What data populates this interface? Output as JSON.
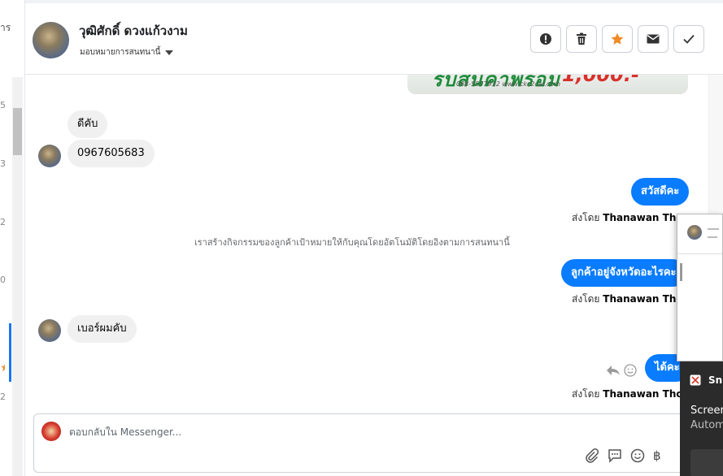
{
  "left_sidebar": {
    "fragment_top": "าร",
    "fragments": [
      "5",
      "3",
      "2",
      "0",
      "2"
    ]
  },
  "header": {
    "contact_name": "วุฒิศักดิ์ ดวงแก้วงาม",
    "assign_label": "มอบหมายการสนทนานี้",
    "actions": [
      {
        "icon": "alert-icon",
        "label": "Mark as spam"
      },
      {
        "icon": "trash-icon",
        "label": "Delete"
      },
      {
        "icon": "star-icon",
        "label": "Star"
      },
      {
        "icon": "envelope-icon",
        "label": "Mark as unread"
      },
      {
        "icon": "check-icon",
        "label": "Mark as done"
      }
    ]
  },
  "chat": {
    "image_banner": {
      "big_text": "รับสินค้าพร้อม",
      "price_text": "1,000.-",
      "small_text": "088-5577932  www.ckc2car.com"
    },
    "messages": [
      {
        "side": "in",
        "text": "ดีคับ"
      },
      {
        "side": "in",
        "text": "0967605683"
      },
      {
        "side": "out",
        "text": "สวัสดีคะ",
        "sent_by_prefix": "ส่งโดย",
        "sent_by": "Thanawan Thon"
      },
      {
        "side": "out",
        "text": "ลูกค้าอยู่จังหวัดอะไรคะ",
        "sent_by_prefix": "ส่งโดย",
        "sent_by": "Thanawan Thon"
      },
      {
        "side": "in",
        "text": "เบอร์ผมคับ"
      },
      {
        "side": "out",
        "text": "ได้คะ",
        "sent_by_prefix": "ส่งโดย",
        "sent_by": "Thanawan Thon"
      }
    ],
    "system_note": "เราสร้างกิจกรรมของลูกค้าเป้าหมายให้กับคุณโดยอัตโนมัติโดยอิงตามการสนทนานี้"
  },
  "composer": {
    "placeholder": "ตอบกลับใน Messenger...",
    "tools": [
      "paperclip-icon",
      "chat-bubble-icon",
      "emoji-icon",
      "baht-icon"
    ],
    "baht_symbol": "฿"
  },
  "toast": {
    "app_name": "Sni",
    "title": "Screen",
    "body": "Autom"
  },
  "colors": {
    "accent": "#0a7cff",
    "star": "#f08a24",
    "incoming_bubble": "#f0f0f0"
  }
}
